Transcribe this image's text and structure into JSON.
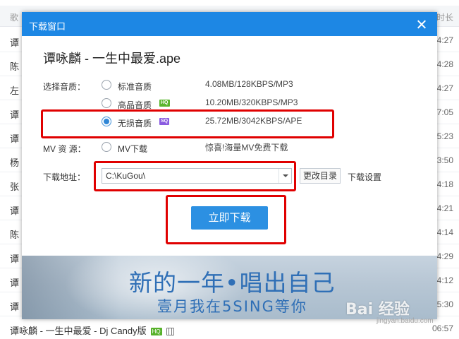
{
  "background_list": {
    "header": {
      "song_col": "歌",
      "duration_col": "时长"
    },
    "rows": [
      {
        "name": "谭",
        "duration": "4:27"
      },
      {
        "name": "陈",
        "duration": "4:28"
      },
      {
        "name": "左",
        "duration": "4:27"
      },
      {
        "name": "谭",
        "duration": "7:05"
      },
      {
        "name": "谭",
        "duration": "5:23"
      },
      {
        "name": "杨",
        "duration": "3:50"
      },
      {
        "name": "张",
        "duration": "4:18"
      },
      {
        "name": "谭",
        "duration": "4:21"
      },
      {
        "name": "陈",
        "duration": "4:14"
      },
      {
        "name": "谭",
        "duration": "4:29"
      },
      {
        "name": "谭",
        "duration": "4:12"
      },
      {
        "name": "谭",
        "duration": "5:30"
      },
      {
        "name": "谭咏麟 - 一生中最爱 - Dj Candy版",
        "duration": "06:57",
        "hq_badge": "HQ"
      }
    ]
  },
  "dialog": {
    "title": "下载窗口",
    "song_title": "谭咏麟 - 一生中最爱.ape",
    "quality_label": "选择音质：",
    "quality_options": [
      {
        "label": "标准音质",
        "info": "4.08MB/128KBPS/MP3",
        "badge": "",
        "selected": false
      },
      {
        "label": "高品音质",
        "info": "10.20MB/320KBPS/MP3",
        "badge": "HQ",
        "selected": false
      },
      {
        "label": "无损音质",
        "info": "25.72MB/3042KBPS/APE",
        "badge": "SQ",
        "selected": true
      }
    ],
    "mv_label": "MV 资 源：",
    "mv_option": {
      "label": "MV下载",
      "info": "惊喜!海量MV免费下载"
    },
    "path_label": "下载地址：",
    "path_value": "C:\\KuGou\\",
    "change_dir_button": "更改目录",
    "settings_link": "下载设置",
    "download_button": "立即下载",
    "banner": {
      "line1": "新的一年•唱出自己",
      "line2": "壹月我在5SING等你"
    }
  },
  "watermark": {
    "main": "Bai 经验",
    "sub": "jingyan.baidu.com"
  },
  "colors": {
    "titlebar": "#1d87e4",
    "primary_button": "#2c90e2",
    "highlight_box": "#e00000",
    "hq_badge": "#5ab52d",
    "sq_badge": "#8a5be0"
  }
}
